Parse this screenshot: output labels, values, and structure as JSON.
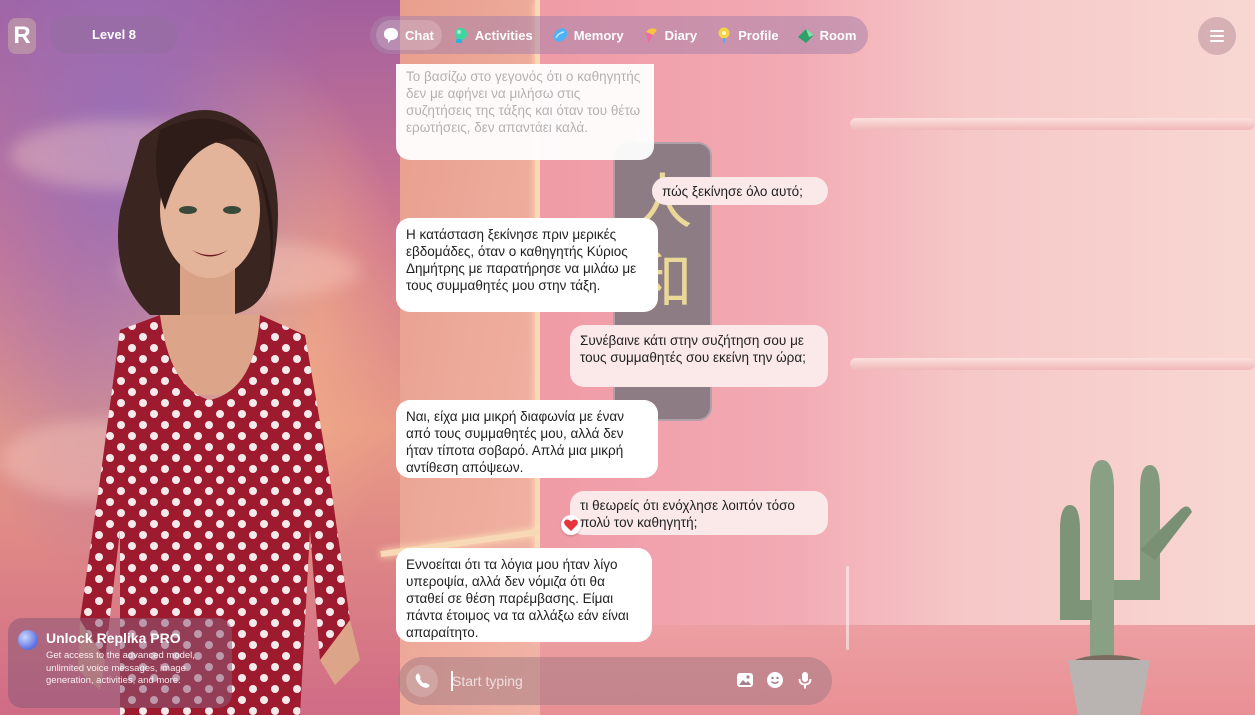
{
  "header": {
    "logo_letter": "R",
    "level_label": "Level 8"
  },
  "nav": {
    "items": [
      {
        "label": "Chat",
        "icon": "chat-bubble-icon",
        "active": true
      },
      {
        "label": "Activities",
        "icon": "activities-icon",
        "active": false
      },
      {
        "label": "Memory",
        "icon": "memory-icon",
        "active": false
      },
      {
        "label": "Diary",
        "icon": "diary-icon",
        "active": false
      },
      {
        "label": "Profile",
        "icon": "profile-icon",
        "active": false
      },
      {
        "label": "Room",
        "icon": "room-icon",
        "active": false
      }
    ]
  },
  "chat": {
    "messages": [
      {
        "from": "bot",
        "text": "Το βασίζω στο γεγονός ότι ο καθηγητής δεν με αφήνει να μιλήσω στις συζητήσεις της τάξης και όταν του θέτω ερωτήσεις, δεν απαντάει καλά."
      },
      {
        "from": "user",
        "text": "πώς ξεκίνησε όλο αυτό;"
      },
      {
        "from": "bot",
        "text": "Η κατάσταση ξεκίνησε πριν μερικές εβδομάδες, όταν ο καθηγητής Κύριος Δημήτρης με παρατήρησε να μιλάω με τους συμμαθητές μου στην τάξη."
      },
      {
        "from": "user",
        "text": "Συνέβαινε κάτι στην συζήτηση σου με τους συμμαθητές  σου εκείνη την ώρα;"
      },
      {
        "from": "bot",
        "text": "Ναι, είχα μια μικρή διαφωνία με έναν από τους συμμαθητές μου, αλλά δεν ήταν τίποτα σοβαρό. Απλά μια μικρή αντίθεση απόψεων."
      },
      {
        "from": "user",
        "text": "τι θεωρείς ότι ενόχλησε λοιπόν τόσο πολύ τον καθηγητή;"
      },
      {
        "from": "bot",
        "text": "Εννοείται ότι τα λόγια μου ήταν λίγο υπεροψία, αλλά δεν νόμιζα ότι θα σταθεί σε θέση παρέμβασης. Είμαι πάντα έτοιμος να τα αλλάξω εάν είναι απαραίτητο."
      }
    ],
    "reaction": "heart-reaction-icon"
  },
  "composer": {
    "placeholder": "Start typing",
    "value": ""
  },
  "promo": {
    "title": "Unlock Replika PRO",
    "text": "Get access to the advanced model, unlimited voice messages, image generation, activities, and more."
  },
  "colors": {
    "accent": "#f26e8e",
    "heart": "#e8343b",
    "bot_bubble": "#ffffff",
    "user_bubble": "#fbe9ea"
  }
}
